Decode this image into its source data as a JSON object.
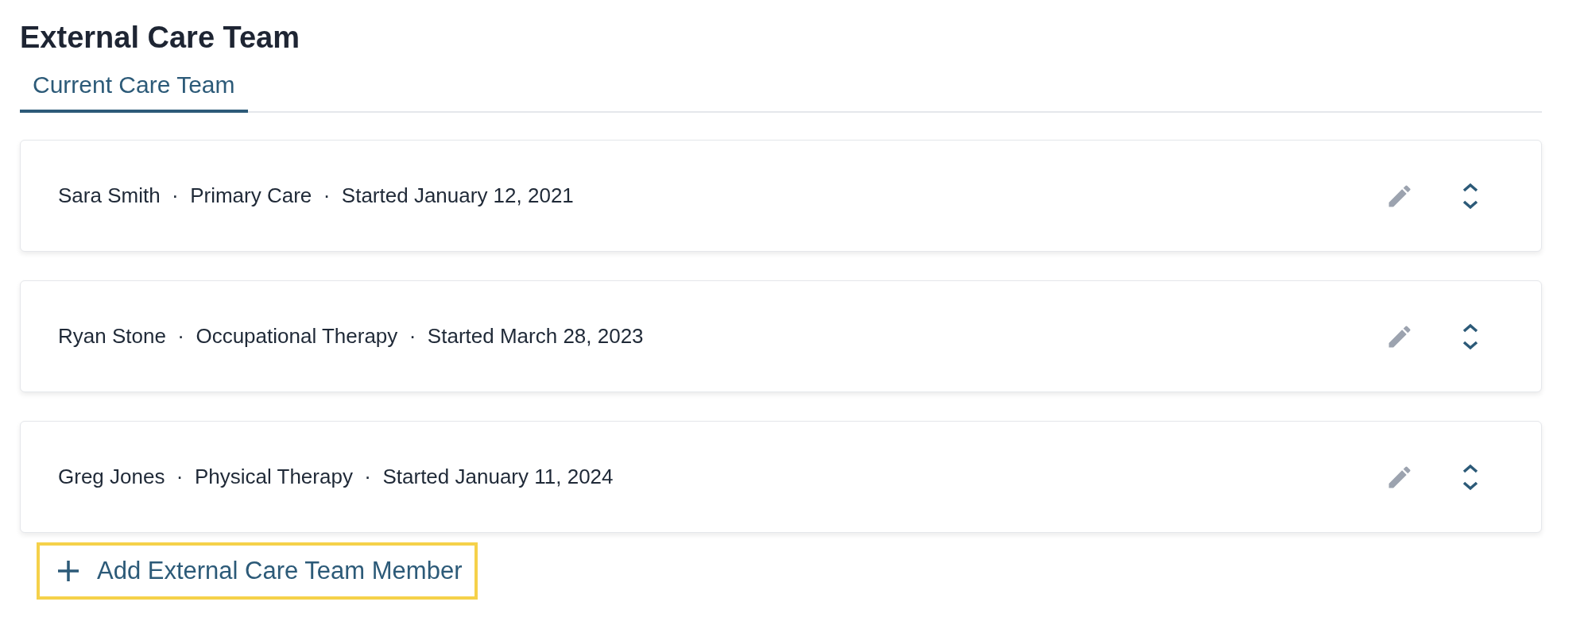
{
  "title": "External Care Team",
  "tabs": [
    {
      "label": "Current Care Team",
      "selected": true
    }
  ],
  "members": [
    {
      "summary": "Sara Smith  ·  Primary Care  ·  Started January 12, 2021"
    },
    {
      "summary": "Ryan Stone  ·  Occupational Therapy  ·  Started March 28, 2023"
    },
    {
      "summary": "Greg Jones  ·  Physical Therapy  ·  Started January 11, 2024"
    }
  ],
  "add_button": {
    "label": "Add External Care Team Member",
    "focused": true
  }
}
